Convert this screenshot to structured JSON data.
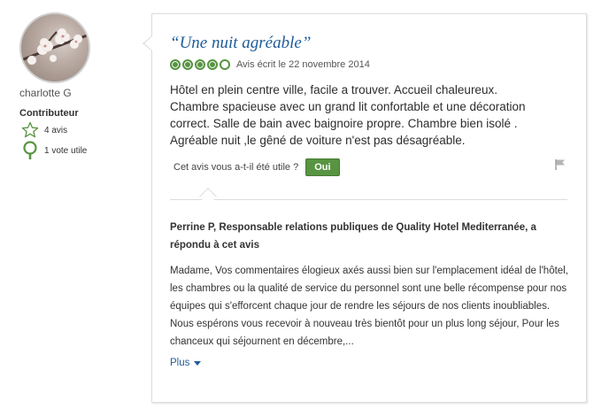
{
  "member": {
    "username": "charlotte G",
    "badge_title": "Contributeur",
    "reviews_count": "4 avis",
    "helpful_votes": "1 vote utile"
  },
  "review": {
    "title": "“Une nuit agréable”",
    "rating_bubbles": 4,
    "rating_max": 5,
    "date_text": "Avis écrit le 22 novembre 2014",
    "body": "Hôtel en plein centre ville, facile a trouver. Accueil chaleureux. Chambre spacieuse avec un grand lit confortable et une décoration correct. Salle de bain avec baignoire propre. Chambre bien isolé . Agréable nuit ,le gêné de voiture n'est pas désagréable.",
    "helpful_question": "Cet avis vous a-t-il été utile ?",
    "yes_button": "Oui"
  },
  "response": {
    "header": "Perrine P, Responsable relations publiques de Quality Hotel Mediterranée, a répondu à cet avis",
    "body": "Madame, Vos commentaires élogieux axés aussi bien sur l'emplacement idéal de l'hôtel, les chambres ou la qualité de service du personnel sont une belle récompense pour nos équipes qui s'efforcent chaque jour de rendre les séjours de nos clients inoubliables. Nous espérons vous recevoir à nouveau très bientôt pour un plus long séjour, Pour les chanceux qui séjournent en décembre,...",
    "more_link": "Plus"
  },
  "colors": {
    "title_blue": "#1f5c99",
    "rating_green": "#589442",
    "border": "#dcdcdc"
  }
}
